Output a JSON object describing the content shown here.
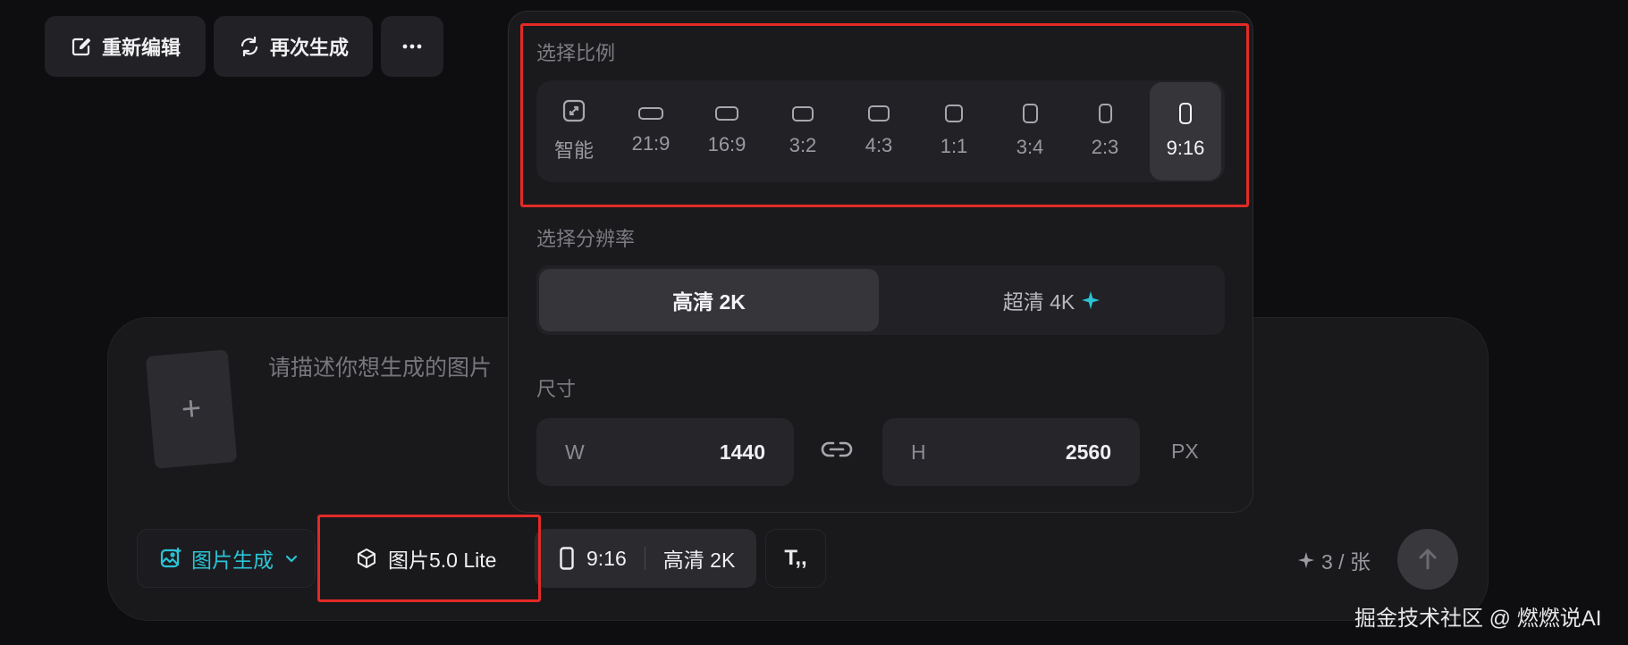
{
  "top_actions": {
    "reedit_label": "重新编辑",
    "regenerate_label": "再次生成",
    "more_icon": "more-horizontal-icon"
  },
  "popup": {
    "ratio_title": "选择比例",
    "ratios": [
      {
        "label": "智能",
        "selected": false
      },
      {
        "label": "21:9",
        "selected": false
      },
      {
        "label": "16:9",
        "selected": false
      },
      {
        "label": "3:2",
        "selected": false
      },
      {
        "label": "4:3",
        "selected": false
      },
      {
        "label": "1:1",
        "selected": false
      },
      {
        "label": "3:4",
        "selected": false
      },
      {
        "label": "2:3",
        "selected": false
      },
      {
        "label": "9:16",
        "selected": true
      }
    ],
    "resolution_title": "选择分辨率",
    "resolutions": [
      {
        "label": "高清 2K",
        "selected": true
      },
      {
        "label": "超清 4K",
        "selected": false
      }
    ],
    "size_title": "尺寸",
    "width_label": "W",
    "width_value": "1440",
    "height_label": "H",
    "height_value": "2560",
    "unit": "PX"
  },
  "composer": {
    "upload_symbol": "+",
    "placeholder": "请描述你想生成的图片",
    "mode_label": "图片生成",
    "model_label": "图片5.0 Lite",
    "ratio_value": "9:16",
    "resolution_value": "高清 2K",
    "text_tool_symbol": "T,,",
    "credits": "3 / 张"
  },
  "colors": {
    "accent": "#2bc4d6",
    "highlight": "#e32a26",
    "background": "#0e0e10"
  },
  "watermark": "掘金技术社区 @ 燃燃说AI"
}
